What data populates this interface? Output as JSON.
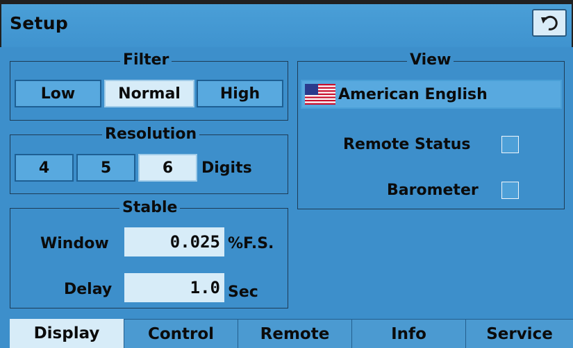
{
  "header": {
    "title": "Setup",
    "back_icon": "refresh-back-icon"
  },
  "filter": {
    "legend": "Filter",
    "options": [
      "Low",
      "Normal",
      "High"
    ],
    "selected": "Normal"
  },
  "resolution": {
    "legend": "Resolution",
    "options": [
      "4",
      "5",
      "6"
    ],
    "selected": "6",
    "unit": "Digits"
  },
  "stable": {
    "legend": "Stable",
    "window_label": "Window",
    "window_value": "0.025",
    "window_unit": "%F.S.",
    "delay_label": "Delay",
    "delay_value": "1.0",
    "delay_unit": "Sec"
  },
  "view": {
    "legend": "View",
    "language": "American English",
    "remote_status_label": "Remote Status",
    "remote_status_checked": false,
    "barometer_label": "Barometer",
    "barometer_checked": false
  },
  "tabs": [
    "Display",
    "Control",
    "Remote",
    "Info",
    "Service"
  ],
  "active_tab": "Display",
  "colors": {
    "background": "#3d8fcb",
    "selected": "#d7ecf8",
    "button": "#58a9df",
    "text": "#0b0b0b"
  }
}
